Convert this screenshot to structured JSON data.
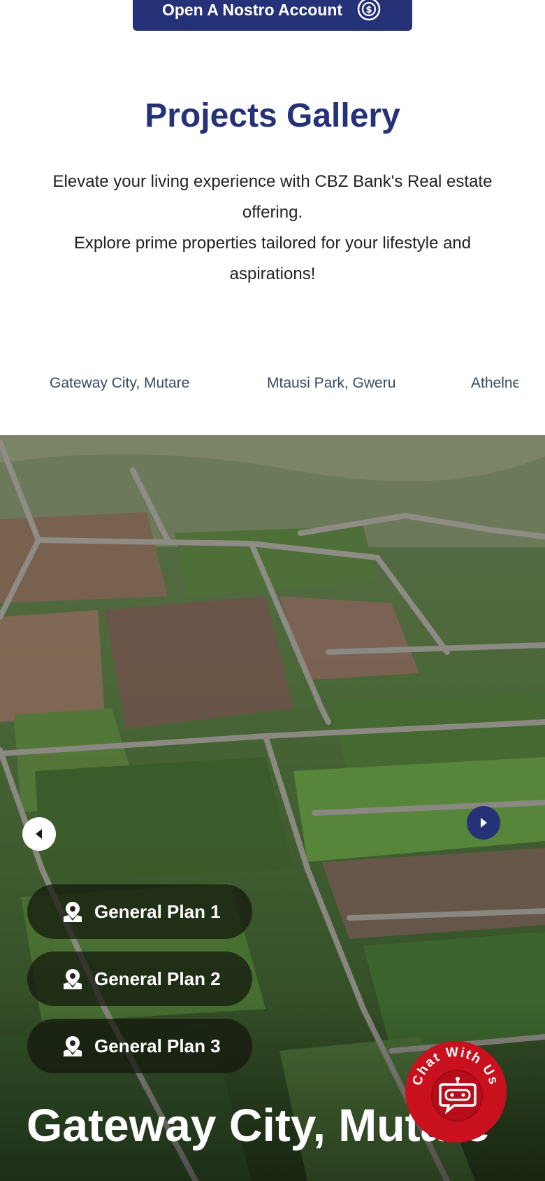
{
  "cta": {
    "label": "Open A Nostro Account",
    "icon": "dollar-coin-icon"
  },
  "gallery": {
    "title": "Projects Gallery",
    "description_line1": "Elevate your living experience with CBZ Bank's Real estate offering.",
    "description_line2": "Explore prime properties tailored for your lifestyle and aspirations!"
  },
  "tabs": [
    {
      "label": "Gateway City, Mutare"
    },
    {
      "label": "Mtausi Park, Gweru"
    },
    {
      "label": "Athelne"
    }
  ],
  "hero": {
    "title": "Gateway City, Mutare",
    "plans": [
      {
        "label": "General Plan 1",
        "icon": "map-pin-icon"
      },
      {
        "label": "General Plan 2",
        "icon": "map-pin-icon"
      },
      {
        "label": "General Plan 3",
        "icon": "map-pin-icon"
      }
    ]
  },
  "chat": {
    "label": "Chat With Us",
    "icon": "robot-chat-icon"
  },
  "colors": {
    "brand": "#263278",
    "chat": "#c8101e"
  }
}
